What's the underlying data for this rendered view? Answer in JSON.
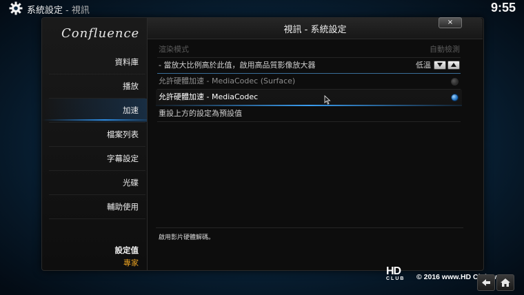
{
  "topbar": {
    "breadcrumb_main": "系統設定",
    "breadcrumb_sub": "- 視訊",
    "clock": "9:55"
  },
  "dialog": {
    "title": "視訊 - 系統設定",
    "close_label": "×"
  },
  "sidebar": {
    "logo": "Confluence",
    "items": [
      {
        "label": "資料庫"
      },
      {
        "label": "播放"
      },
      {
        "label": "加速",
        "active": true
      },
      {
        "label": "檔案列表"
      },
      {
        "label": "字幕設定"
      },
      {
        "label": "光碟"
      },
      {
        "label": "輔助使用"
      }
    ],
    "settings_level_title": "設定值",
    "settings_level_value": "專家"
  },
  "settings": [
    {
      "label": "渲染模式",
      "value": "自動檢測",
      "state": "disabled"
    },
    {
      "label": "- 當放大比例高於此值，啟用高品質影像放大器",
      "value": "低溫",
      "control": "spinner"
    },
    {
      "label": "允許硬體加速 - MediaCodec (Surface)",
      "control": "radio",
      "checked": false
    },
    {
      "label": "允許硬體加速 - MediaCodec",
      "control": "radio",
      "checked": true,
      "focused": true
    },
    {
      "label": "重設上方的設定為預設值"
    }
  ],
  "description": "啟用影片硬體解碼。",
  "watermark": {
    "logo_top": "HD",
    "logo_bottom": "CLUB",
    "text": "© 2016  www.HD Club.tw"
  },
  "colors": {
    "accent": "#2e8be0",
    "level_value": "#e8a020"
  },
  "icons": {
    "settings": "gear-icon",
    "back": "back-arrow-icon",
    "home": "home-icon"
  }
}
